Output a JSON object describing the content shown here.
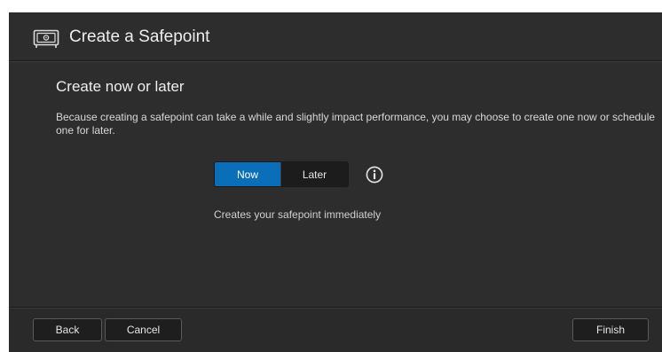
{
  "header": {
    "icon": "safe-icon",
    "title": "Create a Safepoint"
  },
  "content": {
    "section_title": "Create now or later",
    "description": "Because creating a safepoint can take a while and slightly impact performance, you may choose to create one now or schedule one for later.",
    "toggle": {
      "options": [
        {
          "label": "Now",
          "selected": true
        },
        {
          "label": "Later",
          "selected": false
        }
      ]
    },
    "info_icon": "info-icon",
    "hint": "Creates your safepoint immediately"
  },
  "footer": {
    "back_label": "Back",
    "cancel_label": "Cancel",
    "finish_label": "Finish"
  },
  "colors": {
    "background": "#2d2d2d",
    "accent": "#0a6fb8"
  }
}
